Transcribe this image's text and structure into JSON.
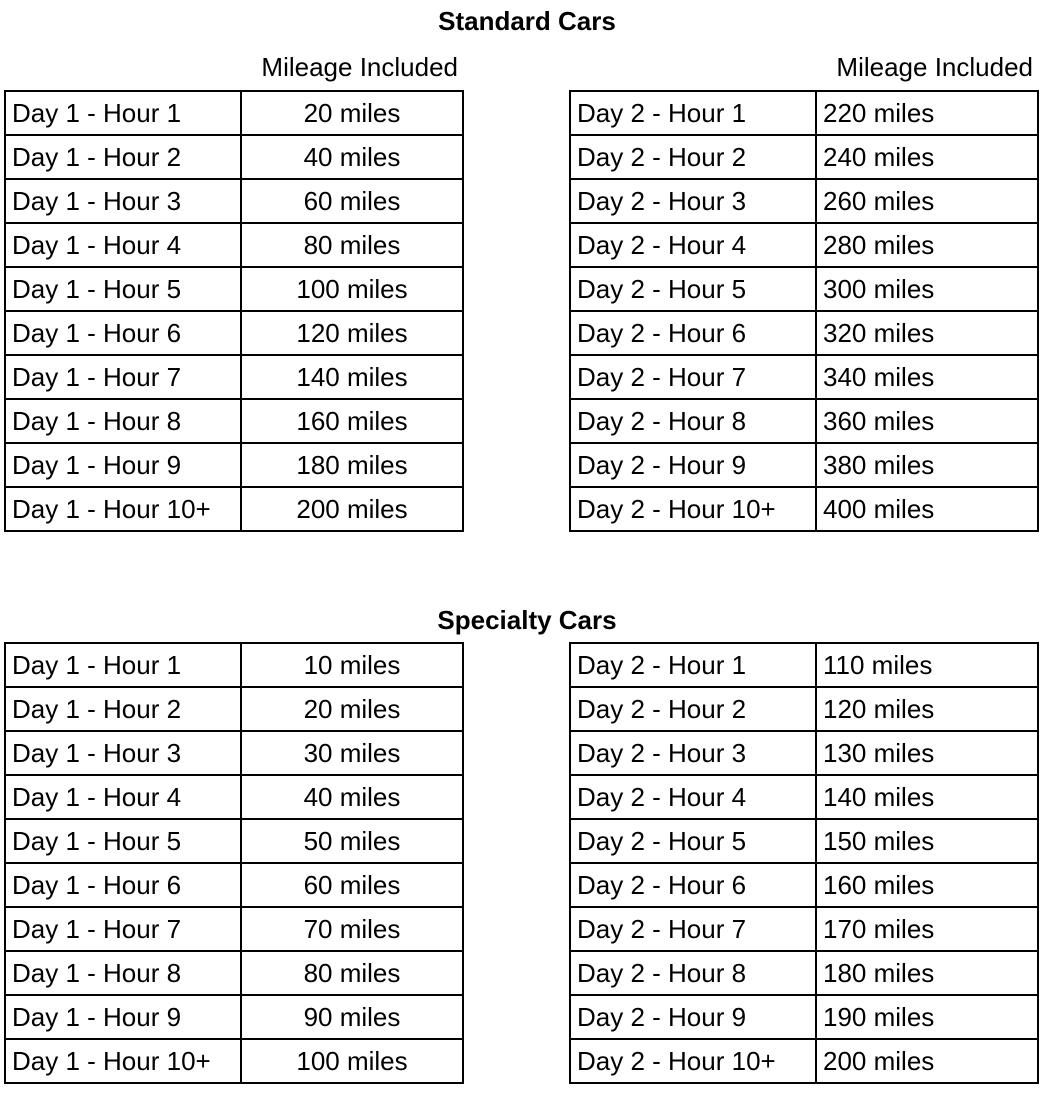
{
  "sections": [
    {
      "title": "Standard Cars",
      "column_header": "Mileage Included",
      "day1": [
        {
          "label": "Day 1 - Hour 1",
          "value": "20 miles"
        },
        {
          "label": "Day 1 - Hour 2",
          "value": "40 miles"
        },
        {
          "label": "Day 1 - Hour 3",
          "value": "60 miles"
        },
        {
          "label": "Day 1 - Hour 4",
          "value": "80 miles"
        },
        {
          "label": "Day 1 - Hour 5",
          "value": "100 miles"
        },
        {
          "label": "Day 1 - Hour 6",
          "value": "120 miles"
        },
        {
          "label": "Day 1 - Hour 7",
          "value": "140 miles"
        },
        {
          "label": "Day 1 - Hour 8",
          "value": "160 miles"
        },
        {
          "label": "Day 1 - Hour 9",
          "value": "180 miles"
        },
        {
          "label": "Day 1 - Hour 10+",
          "value": "200 miles"
        }
      ],
      "day2": [
        {
          "label": "Day 2 - Hour 1",
          "value": "220 miles"
        },
        {
          "label": "Day 2 - Hour 2",
          "value": "240 miles"
        },
        {
          "label": "Day 2 - Hour 3",
          "value": "260 miles"
        },
        {
          "label": "Day 2 - Hour 4",
          "value": "280 miles"
        },
        {
          "label": "Day 2 - Hour 5",
          "value": "300 miles"
        },
        {
          "label": "Day 2 - Hour 6",
          "value": "320 miles"
        },
        {
          "label": "Day 2 - Hour 7",
          "value": "340 miles"
        },
        {
          "label": "Day 2 - Hour 8",
          "value": "360 miles"
        },
        {
          "label": "Day 2 - Hour 9",
          "value": "380 miles"
        },
        {
          "label": "Day 2 - Hour 10+",
          "value": "400 miles"
        }
      ]
    },
    {
      "title": "Specialty Cars",
      "day1": [
        {
          "label": "Day 1 - Hour 1",
          "value": "10 miles"
        },
        {
          "label": "Day 1 - Hour 2",
          "value": "20 miles"
        },
        {
          "label": "Day 1 - Hour 3",
          "value": "30 miles"
        },
        {
          "label": "Day 1 - Hour 4",
          "value": "40 miles"
        },
        {
          "label": "Day 1 - Hour 5",
          "value": "50 miles"
        },
        {
          "label": "Day 1 - Hour 6",
          "value": "60 miles"
        },
        {
          "label": "Day 1 - Hour 7",
          "value": "70 miles"
        },
        {
          "label": "Day 1 - Hour 8",
          "value": "80 miles"
        },
        {
          "label": "Day 1 - Hour 9",
          "value": "90 miles"
        },
        {
          "label": "Day 1 - Hour 10+",
          "value": "100 miles"
        }
      ],
      "day2": [
        {
          "label": "Day 2 - Hour 1",
          "value": "110 miles"
        },
        {
          "label": "Day 2 - Hour 2",
          "value": "120 miles"
        },
        {
          "label": "Day 2 - Hour 3",
          "value": "130 miles"
        },
        {
          "label": "Day 2 - Hour 4",
          "value": "140 miles"
        },
        {
          "label": "Day 2 - Hour 5",
          "value": "150 miles"
        },
        {
          "label": "Day 2 - Hour 6",
          "value": "160 miles"
        },
        {
          "label": "Day 2 - Hour 7",
          "value": "170 miles"
        },
        {
          "label": "Day 2 - Hour 8",
          "value": "180 miles"
        },
        {
          "label": "Day 2 - Hour 9",
          "value": "190 miles"
        },
        {
          "label": "Day 2 - Hour 10+",
          "value": "200 miles"
        }
      ]
    }
  ]
}
